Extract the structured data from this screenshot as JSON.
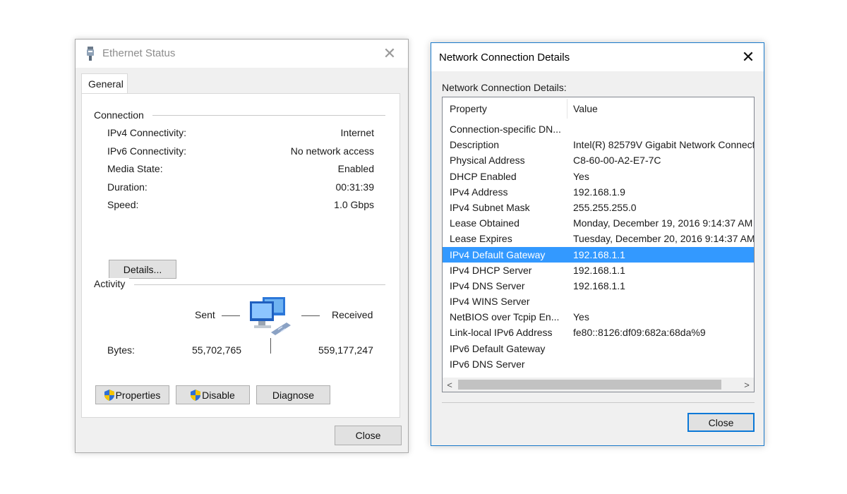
{
  "ethernet_status": {
    "title": "Ethernet Status",
    "tab": "General",
    "connection": {
      "label": "Connection",
      "rows": [
        {
          "label": "IPv4 Connectivity:",
          "value": "Internet"
        },
        {
          "label": "IPv6 Connectivity:",
          "value": "No network access"
        },
        {
          "label": "Media State:",
          "value": "Enabled"
        },
        {
          "label": "Duration:",
          "value": "00:31:39"
        },
        {
          "label": "Speed:",
          "value": "1.0 Gbps"
        }
      ],
      "details_button": "Details..."
    },
    "activity": {
      "label": "Activity",
      "sent_label": "Sent",
      "received_label": "Received",
      "bytes_label": "Bytes:",
      "bytes_sent": "55,702,765",
      "bytes_received": "559,177,247"
    },
    "buttons": {
      "properties": "Properties",
      "disable": "Disable",
      "diagnose": "Diagnose",
      "close": "Close"
    },
    "colors": {
      "shield_blue": "#2f6fd6",
      "shield_yellow": "#f5c400"
    }
  },
  "connection_details": {
    "title": "Network Connection Details",
    "label": "Network Connection Details:",
    "columns": [
      "Property",
      "Value"
    ],
    "rows": [
      [
        "Connection-specific DN...",
        ""
      ],
      [
        "Description",
        "Intel(R) 82579V Gigabit Network Connect"
      ],
      [
        "Physical Address",
        "C8-60-00-A2-E7-7C"
      ],
      [
        "DHCP Enabled",
        "Yes"
      ],
      [
        "IPv4 Address",
        "192.168.1.9"
      ],
      [
        "IPv4 Subnet Mask",
        "255.255.255.0"
      ],
      [
        "Lease Obtained",
        "Monday, December 19, 2016 9:14:37 AM"
      ],
      [
        "Lease Expires",
        "Tuesday, December 20, 2016 9:14:37 AM"
      ],
      [
        "IPv4 Default Gateway",
        "192.168.1.1"
      ],
      [
        "IPv4 DHCP Server",
        "192.168.1.1"
      ],
      [
        "IPv4 DNS Server",
        "192.168.1.1"
      ],
      [
        "IPv4 WINS Server",
        ""
      ],
      [
        "NetBIOS over Tcpip En...",
        "Yes"
      ],
      [
        "Link-local IPv6 Address",
        "fe80::8126:df09:682a:68da%9"
      ],
      [
        "IPv6 Default Gateway",
        ""
      ],
      [
        "IPv6 DNS Server",
        ""
      ]
    ],
    "selected_row": 8,
    "close_button": "Close",
    "colors": {
      "selection": "#3399ff",
      "accent_border": "#0a78d7"
    }
  },
  "icons": {
    "title_icon": "ethernet-plug-icon",
    "close": "close-icon",
    "network": "network-computers-icon",
    "shield": "uac-shield-icon",
    "scroll_left": "chevron-left-icon",
    "scroll_right": "chevron-right-icon"
  }
}
